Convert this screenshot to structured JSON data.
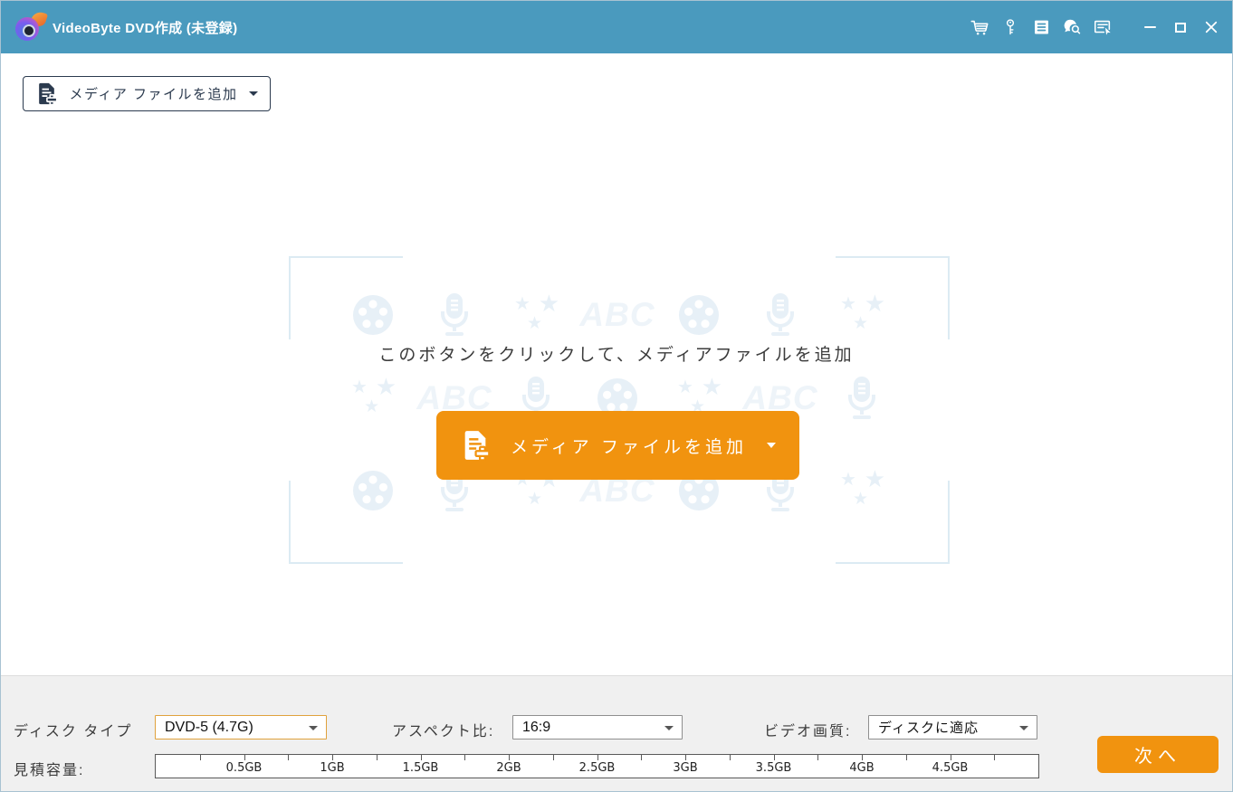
{
  "titlebar": {
    "title": "VideoByte DVD作成 (未登録)",
    "icons": [
      "cart-icon",
      "key-icon",
      "register-icon",
      "feedback-icon",
      "menu-icon",
      "minimize-icon",
      "maximize-icon",
      "close-icon"
    ]
  },
  "toolbar": {
    "add_media_label": "メディア ファイルを追加"
  },
  "main": {
    "hint": "このボタンをクリックして、メディアファイルを追加",
    "add_media_label": "メディア ファイルを追加",
    "watermark": {
      "abc": "ABC",
      "rows": [
        [
          "film",
          "mic",
          "stars",
          "abc",
          "film",
          "mic",
          "stars"
        ],
        [
          "stars",
          "abc",
          "mic",
          "film",
          "stars",
          "abc",
          "mic"
        ],
        [
          "film",
          "mic",
          "stars",
          "abc",
          "film",
          "mic",
          "stars"
        ]
      ]
    }
  },
  "bottom": {
    "disc_type_label": "ディスク タイプ",
    "disc_type_value": "DVD-5 (4.7G)",
    "aspect_label": "アスペクト比:",
    "aspect_value": "16:9",
    "quality_label": "ビデオ画質:",
    "quality_value": "ディスクに適応",
    "capacity_label": "見積容量:",
    "capacity": {
      "max_gb": 5,
      "tick_step_gb": 0.25,
      "labels": [
        {
          "gb": 0.5,
          "text": "0.5GB"
        },
        {
          "gb": 1.0,
          "text": "1GB"
        },
        {
          "gb": 1.5,
          "text": "1.5GB"
        },
        {
          "gb": 2.0,
          "text": "2GB"
        },
        {
          "gb": 2.5,
          "text": "2.5GB"
        },
        {
          "gb": 3.0,
          "text": "3GB"
        },
        {
          "gb": 3.5,
          "text": "3.5GB"
        },
        {
          "gb": 4.0,
          "text": "4GB"
        },
        {
          "gb": 4.5,
          "text": "4.5GB"
        }
      ]
    },
    "next_label": "次へ"
  },
  "colors": {
    "titlebar": "#4A9ABE",
    "accent_orange": "#F1930F",
    "ink": "#2B3A4E",
    "watermark": "#E7F0F7"
  }
}
